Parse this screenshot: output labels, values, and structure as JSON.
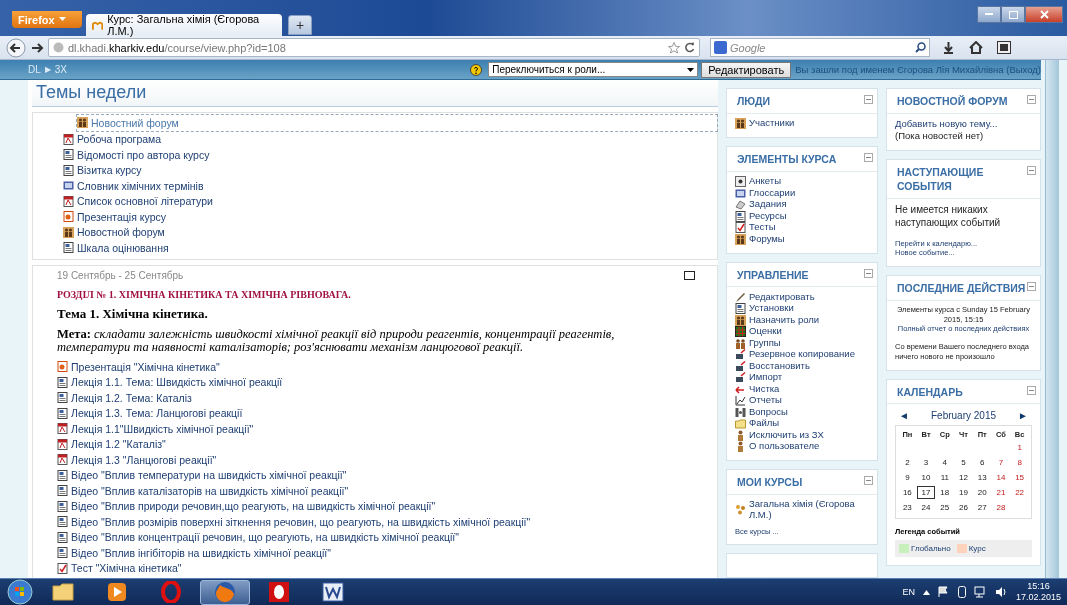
{
  "browser": {
    "menu_button": "Firefox",
    "tab_title": "Курс: Загальна хімія (Єгорова Л.М.)",
    "new_tab": "+",
    "url_host_prefix": "dl.khadi.",
    "url_host_main": "kharkiv.edu",
    "url_path": "/course/view.php?id=108",
    "search_placeholder": "Google"
  },
  "header": {
    "breadcrumb": [
      {
        "label": "DL"
      },
      {
        "label": "3X"
      }
    ],
    "breadcrumb_separator": "▶",
    "role_select": "Переключиться к роли...",
    "edit_button": "Редактировать",
    "login_info": "Вы зашли под именем Єгорова Лія Михайлівна (Выход)"
  },
  "main": {
    "title": "Темы недели",
    "indented_item": {
      "kind": "forum",
      "label": "Новостний форум",
      "focused": true
    },
    "items": [
      {
        "kind": "pdf",
        "label": "Робоча програма"
      },
      {
        "kind": "page",
        "label": "Відомості про автора курсу"
      },
      {
        "kind": "page",
        "label": "Візитка курсу"
      },
      {
        "kind": "glossary",
        "label": "Словник хімічних термінів"
      },
      {
        "kind": "pdf",
        "label": "Список основної літератури"
      },
      {
        "kind": "presentation",
        "label": "Презентація курсу"
      },
      {
        "kind": "forum",
        "label": "Новостной форум"
      },
      {
        "kind": "page",
        "label": "Шкала оцінювання"
      }
    ],
    "week": {
      "dates": "19 Сентябрь - 25 Сентябрь",
      "section_title": "РОЗДІЛ № 1. ХІМІЧНА КІНЕТИКА ТА ХІМІЧНА РІВНОВАГА.",
      "topic": "Тема 1. Хімічна кінетика.",
      "goal": "**Мета:** *складати залежність швидкості хімічної реакції від природи реагентів, концентрації реагентів, температури та наявності каталізаторів; роз'яснювати механізм ланцюгової реакції.*",
      "items": [
        {
          "kind": "presentation",
          "label": "Презентація \"Хімічна кінетика\""
        },
        {
          "kind": "page",
          "label": "Лекція 1.1. Тема: Швидкість хімічної реакції"
        },
        {
          "kind": "page",
          "label": "Лекція 1.2. Тема: Каталіз"
        },
        {
          "kind": "page",
          "label": "Лекція 1.3. Тема: Ланцюгові реакції"
        },
        {
          "kind": "pdf",
          "label": "Лекція 1.1\"Швидкість хімічної реакції\""
        },
        {
          "kind": "pdf",
          "label": "Лекція 1.2 \"Каталіз\""
        },
        {
          "kind": "pdf",
          "label": "Лекція 1.3 \"Ланцюгові реакції\""
        },
        {
          "kind": "page",
          "label": "Відео \"Вплив температури на швидкість хімічної реакції\""
        },
        {
          "kind": "page",
          "label": "Відео \"Вплив каталізаторів на швидкість хімічної реакції\""
        },
        {
          "kind": "page",
          "label": "Відео \"Вплив природи речовин,що реагують, на швидкість хімічної реакції\""
        },
        {
          "kind": "page",
          "label": "Відео \"Вплив розмірів поверхні зіткнення речовин, що реагують, на швидкість хімічної реакції\""
        },
        {
          "kind": "page",
          "label": "Відео \"Вплив концентрації речовин, що реагують, на швидкість хімічної реакції\""
        },
        {
          "kind": "page",
          "label": "Відео \"Вплив інгібіторів на швидкість хімічної реакції\""
        },
        {
          "kind": "quiz",
          "label": "Тест \"Хімічна кінетика\""
        }
      ]
    }
  },
  "blocks_left": [
    {
      "title": "ЛЮДИ",
      "items": [
        {
          "kind": "people",
          "label": "Участники"
        }
      ]
    },
    {
      "title": "ЭЛЕМЕНТЫ КУРСА",
      "items": [
        {
          "kind": "choice",
          "label": "Анкеты"
        },
        {
          "kind": "glossary",
          "label": "Глоссарии"
        },
        {
          "kind": "assignment",
          "label": "Задания"
        },
        {
          "kind": "page",
          "label": "Ресурсы"
        },
        {
          "kind": "quiz",
          "label": "Тесты"
        },
        {
          "kind": "forum",
          "label": "Форумы"
        }
      ]
    },
    {
      "title": "УПРАВЛЕНИЕ",
      "items": [
        {
          "kind": "edit",
          "label": "Редактировать"
        },
        {
          "kind": "settings",
          "label": "Установки"
        },
        {
          "kind": "people",
          "label": "Назначить роли"
        },
        {
          "kind": "grades",
          "label": "Оценки"
        },
        {
          "kind": "groups",
          "label": "Группы"
        },
        {
          "kind": "backup",
          "label": "Резервное копирование"
        },
        {
          "kind": "backup",
          "label": "Восстановить"
        },
        {
          "kind": "backup",
          "label": "Импорт"
        },
        {
          "kind": "reset",
          "label": "Чистка"
        },
        {
          "kind": "reports",
          "label": "Отчеты"
        },
        {
          "kind": "questions",
          "label": "Вопросы"
        },
        {
          "kind": "folder",
          "label": "Файлы"
        },
        {
          "kind": "person",
          "label": "Исключить из ЗХ"
        },
        {
          "kind": "person",
          "label": "О пользователе"
        }
      ]
    },
    {
      "title": "МОИ КУРСЫ",
      "items": [
        {
          "kind": "course",
          "label": "Загальна хімія (Єгорова Л.М.)"
        }
      ],
      "footer": "Все курсы ..."
    }
  ],
  "news": {
    "title": "НОВОСТНОЙ ФОРУМ",
    "link": "Добавить новую тему...",
    "note": "(Пока новостей нет)"
  },
  "upcoming": {
    "title": "НАСТУПАЮЩИЕ СОБЫТИЯ",
    "note": "Не имеется никаких наступающих событий",
    "links": [
      "Перейти к календарю...",
      "Новое событие..."
    ]
  },
  "recent": {
    "title": "ПОСЛЕДНИЕ ДЕЙСТВИЯ",
    "since": "Элементы курса с Sunday 15 February 2015, 15:15",
    "report_link": "Полный отчет о последних действиях",
    "note": "Со времени Вашего последнего входа ничего нового не произошло"
  },
  "calendar": {
    "title": "КАЛЕНДАРЬ",
    "prev": "◄",
    "next": "►",
    "month": "February 2015",
    "weekdays": [
      "Пн",
      "Вт",
      "Ср",
      "Чт",
      "Пт",
      "Сб",
      "Вс"
    ],
    "weeks": [
      [
        {
          "kind": "blank"
        },
        {
          "kind": "blank"
        },
        {
          "kind": "blank"
        },
        {
          "kind": "blank"
        },
        {
          "kind": "blank"
        },
        {
          "kind": "blank"
        },
        {
          "kind": "day",
          "day": "1",
          "weekend": true,
          "today": false
        }
      ],
      [
        {
          "kind": "day",
          "day": "2",
          "weekend": false,
          "today": false
        },
        {
          "kind": "day",
          "day": "3",
          "weekend": false,
          "today": false
        },
        {
          "kind": "day",
          "day": "4",
          "weekend": false,
          "today": false
        },
        {
          "kind": "day",
          "day": "5",
          "weekend": false,
          "today": false
        },
        {
          "kind": "day",
          "day": "6",
          "weekend": false,
          "today": false
        },
        {
          "kind": "day",
          "day": "7",
          "weekend": true,
          "today": false
        },
        {
          "kind": "day",
          "day": "8",
          "weekend": true,
          "today": false
        }
      ],
      [
        {
          "kind": "day",
          "day": "9",
          "weekend": false,
          "today": false
        },
        {
          "kind": "day",
          "day": "10",
          "weekend": false,
          "today": false
        },
        {
          "kind": "day",
          "day": "11",
          "weekend": false,
          "today": false
        },
        {
          "kind": "day",
          "day": "12",
          "weekend": false,
          "today": false
        },
        {
          "kind": "day",
          "day": "13",
          "weekend": false,
          "today": false
        },
        {
          "kind": "day",
          "day": "14",
          "weekend": true,
          "today": false
        },
        {
          "kind": "day",
          "day": "15",
          "weekend": true,
          "today": false
        }
      ],
      [
        {
          "kind": "day",
          "day": "16",
          "weekend": false,
          "today": false
        },
        {
          "kind": "day",
          "day": "17",
          "weekend": false,
          "today": true
        },
        {
          "kind": "day",
          "day": "18",
          "weekend": false,
          "today": false
        },
        {
          "kind": "day",
          "day": "19",
          "weekend": false,
          "today": false
        },
        {
          "kind": "day",
          "day": "20",
          "weekend": false,
          "today": false
        },
        {
          "kind": "day",
          "day": "21",
          "weekend": true,
          "today": false
        },
        {
          "kind": "day",
          "day": "22",
          "weekend": true,
          "today": false
        }
      ],
      [
        {
          "kind": "day",
          "day": "23",
          "weekend": false,
          "today": false
        },
        {
          "kind": "day",
          "day": "24",
          "weekend": false,
          "today": false
        },
        {
          "kind": "day",
          "day": "25",
          "weekend": false,
          "today": false
        },
        {
          "kind": "day",
          "day": "26",
          "weekend": false,
          "today": false
        },
        {
          "kind": "day",
          "day": "27",
          "weekend": false,
          "today": false
        },
        {
          "kind": "day",
          "day": "28",
          "weekend": true,
          "today": false
        }
      ]
    ],
    "legend_title": "Легенда событий",
    "legend": [
      {
        "label": "Глобально",
        "color": "#c8f0bc"
      },
      {
        "label": "Курс",
        "color": "#ffd2bc"
      }
    ]
  },
  "taskbar": {
    "apps": [
      {
        "kind": "folder",
        "active": false
      },
      {
        "kind": "media",
        "active": false
      },
      {
        "kind": "opera",
        "active": false
      },
      {
        "kind": "firefox",
        "active": true
      },
      {
        "kind": "opera-box",
        "active": false
      },
      {
        "kind": "word",
        "active": false
      }
    ],
    "language": "EN",
    "time": "15:16",
    "date": "17.02.2015"
  }
}
